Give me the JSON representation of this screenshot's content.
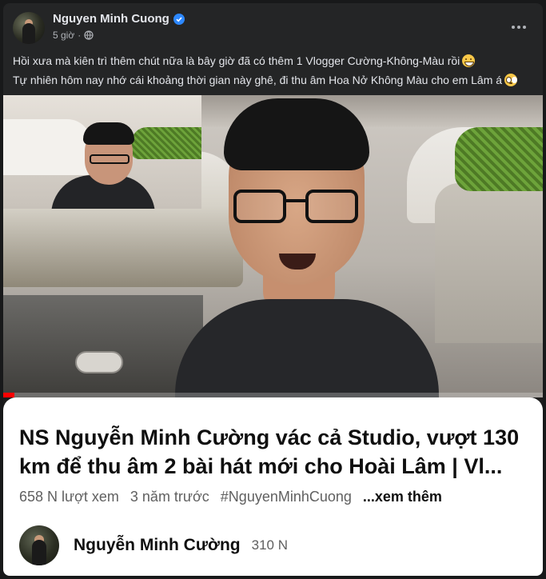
{
  "post": {
    "author": "Nguyen Minh Cuong",
    "time": "5 giờ",
    "caption_lines": [
      "Hồi xưa mà kiên trì thêm chút nữa là bây giờ đã có thêm 1 Vlogger Cường-Không-Màu rồi",
      "Tự nhiên hôm nay nhớ cái khoảng thời gian này ghê, đi thu âm Hoa Nở Không Màu cho em Lâm á"
    ],
    "icons": {
      "verified": "verified-badge-icon",
      "privacy": "globe-icon",
      "more": "more-options-icon",
      "emoji_1": "grinning-emoji",
      "emoji_2": "pleading-emoji"
    }
  },
  "video": {
    "progress": 0.02,
    "title": "NS Nguyễn Minh Cường vác cả Studio, vượt 130 km để thu âm 2 bài hát mới cho Hoài Lâm | Vl...",
    "views": "658 N lượt xem",
    "age": "3 năm trước",
    "hashtag": "#NguyenMinhCuong",
    "see_more": "...xem thêm",
    "channel_name": "Nguyễn Minh Cường",
    "subscribers": "310 N"
  },
  "colors": {
    "background": "#18191a",
    "card": "#242526",
    "accent": "#2d88ff",
    "progress": "#ff0000"
  }
}
